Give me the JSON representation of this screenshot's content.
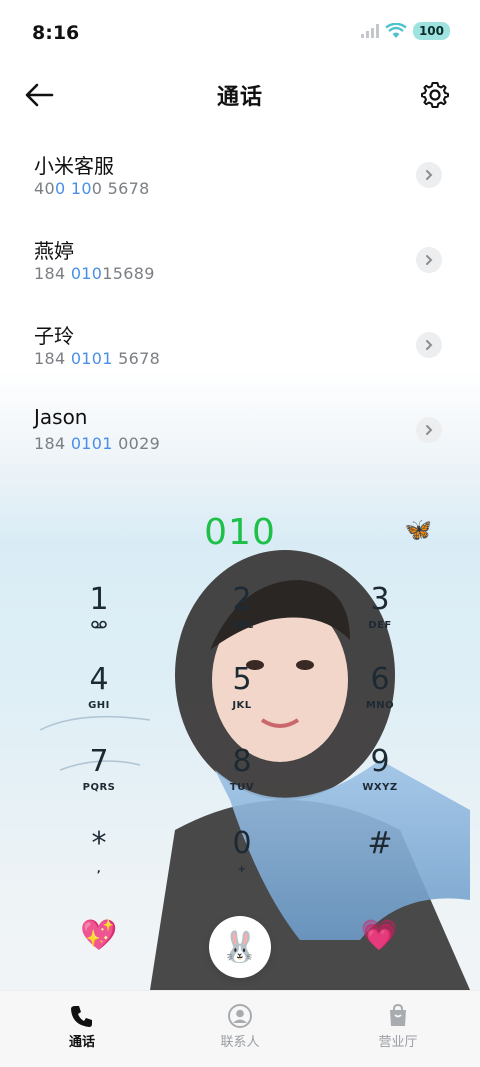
{
  "status_bar": {
    "time": "8:16",
    "battery": "100"
  },
  "header": {
    "title": "通话"
  },
  "contacts": [
    {
      "name": "小米客服",
      "number_parts": [
        "40",
        "0 10",
        "0 5678"
      ]
    },
    {
      "name": "燕婷",
      "number_parts": [
        "184 ",
        "010",
        "15689"
      ]
    },
    {
      "name": "子玲",
      "number_parts": [
        "184 ",
        "0101",
        " 5678"
      ]
    },
    {
      "name": "Jason",
      "number_parts": [
        "184 ",
        "0101",
        " 0029"
      ]
    }
  ],
  "dialer": {
    "input_value": "010",
    "keys": [
      {
        "digit": "1",
        "letters": ""
      },
      {
        "digit": "2",
        "letters": "ABC"
      },
      {
        "digit": "3",
        "letters": "DEF"
      },
      {
        "digit": "4",
        "letters": "GHI"
      },
      {
        "digit": "5",
        "letters": "JKL"
      },
      {
        "digit": "6",
        "letters": "MNO"
      },
      {
        "digit": "7",
        "letters": "PQRS"
      },
      {
        "digit": "8",
        "letters": "TUV"
      },
      {
        "digit": "9",
        "letters": "WXYZ"
      },
      {
        "digit": "*",
        "letters": ","
      },
      {
        "digit": "0",
        "letters": "+"
      },
      {
        "digit": "#",
        "letters": ""
      }
    ],
    "butterfly": "🦋",
    "left_action": "💖",
    "right_action": "💗",
    "call_button": "🐰"
  },
  "bottom_nav": [
    {
      "label": "通话",
      "icon": "phone-icon",
      "active": true
    },
    {
      "label": "联系人",
      "icon": "contacts-icon",
      "active": false
    },
    {
      "label": "营业厅",
      "icon": "store-icon",
      "active": false
    }
  ],
  "colors": {
    "accent_green": "#1fc04a",
    "highlight_blue": "#4a8fe7"
  }
}
